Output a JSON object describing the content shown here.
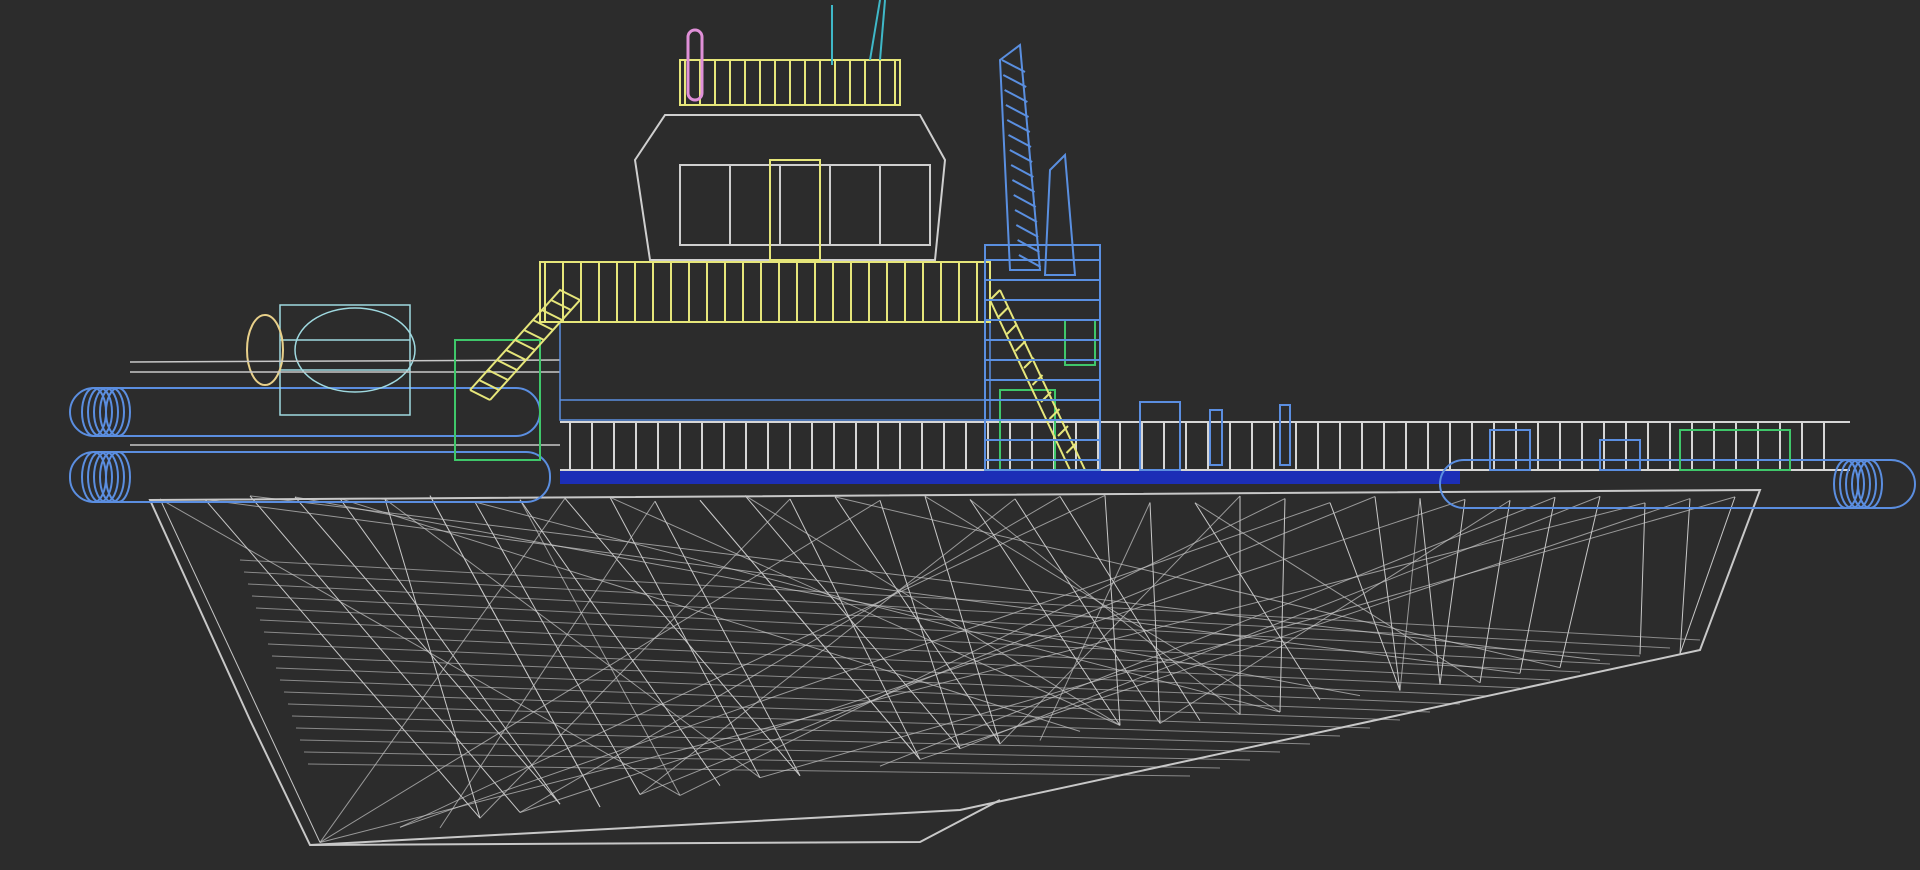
{
  "viewport": {
    "background": "#2c2c2c",
    "render_mode": "wireframe"
  },
  "model": {
    "subject": "tug boat",
    "colors": {
      "hull": "#c8c8c8",
      "railing": "#d6d6d6",
      "wheelhouse": "#cfcfcf",
      "ladders": "#e6e67a",
      "fenders": "#5b8ee0",
      "crane": "#5a8fe0",
      "deck_strip": "#1a2fd0",
      "winch": "#9fd9e0",
      "equipment_green": "#3fc76a",
      "buoy_yellow": "#e8d08a",
      "mast_pink": "#e090d8",
      "antenna_cyan": "#3fb8c8"
    }
  }
}
